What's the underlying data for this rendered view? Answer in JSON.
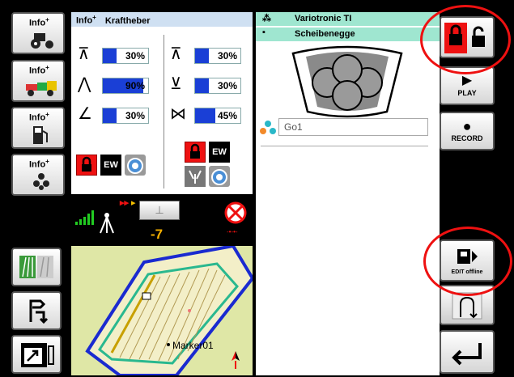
{
  "left_menu": {
    "info_label": "Info",
    "info_sup": "+",
    "items": [
      {
        "name": "tractor"
      },
      {
        "name": "trailer"
      },
      {
        "name": "fuel"
      },
      {
        "name": "implement"
      }
    ]
  },
  "kraftheber": {
    "title_info": "Info",
    "title_sup": "+",
    "title": "Kraftheber",
    "bars_left": [
      {
        "value": "30%",
        "level": 0.3
      },
      {
        "value": "90%",
        "level": 0.9
      },
      {
        "value": "30%",
        "level": 0.3
      }
    ],
    "bars_right": [
      {
        "value": "30%",
        "level": 0.3
      },
      {
        "value": "30%",
        "level": 0.3
      },
      {
        "value": "45%",
        "level": 0.45
      }
    ],
    "ew_label": "EW",
    "ew_label_right": "EW"
  },
  "gps": {
    "value": "-7"
  },
  "map": {
    "marker_label": "Marker01"
  },
  "implement": {
    "tractor_name": "Variotronic TI",
    "implement_name": "Scheibenegge"
  },
  "go_field": {
    "value": "Go1"
  },
  "right_buttons": {
    "play_label": "PLAY",
    "record_label": "RECORD",
    "edit_label": "EDIT offline"
  },
  "colors": {
    "accent_red": "#e11111",
    "bar_blue": "#1a3fd6",
    "teal": "#9fe6d0",
    "map_field": "#dfe7a6"
  }
}
